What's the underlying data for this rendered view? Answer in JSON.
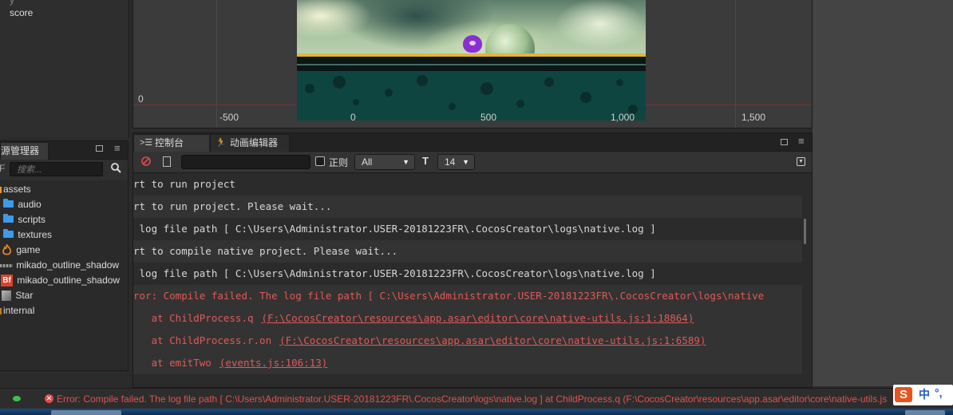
{
  "hierarchy": {
    "items": [
      "score"
    ]
  },
  "assets_panel": {
    "tab_label": "源管理器",
    "search_placeholder": "搜索...",
    "items": [
      {
        "label": "assets",
        "icon": "folder-open-icon"
      },
      {
        "label": "audio",
        "icon": "folder-icon"
      },
      {
        "label": "scripts",
        "icon": "folder-icon"
      },
      {
        "label": "textures",
        "icon": "folder-icon"
      },
      {
        "label": "game",
        "icon": "fire-scene-icon"
      },
      {
        "label": "mikado_outline_shadow",
        "icon": "font-asset-icon"
      },
      {
        "label": "mikado_outline_shadow",
        "icon": "bitmap-font-icon"
      },
      {
        "label": "Star",
        "icon": "prefab-cube-icon"
      },
      {
        "label": "internal",
        "icon": "folder-open-icon"
      }
    ]
  },
  "scene": {
    "y_axis_label": "0",
    "x_axis_labels": [
      "-500",
      "0",
      "500",
      "1,000",
      "1,500"
    ]
  },
  "console": {
    "tabs": {
      "console": "控制台",
      "animation": "动画编辑器"
    },
    "regex_label": "正则",
    "level_select": "All",
    "font_size_select": "14",
    "logs": [
      {
        "text": "rt to run project",
        "type": "info"
      },
      {
        "text": "rt to run project. Please wait...",
        "type": "info"
      },
      {
        "text": " log file path [ C:\\Users\\Administrator.USER-20181223FR\\.CocosCreator\\logs\\native.log ]",
        "type": "info"
      },
      {
        "text": "rt to compile native project. Please wait...",
        "type": "info"
      },
      {
        "text": " log file path [ C:\\Users\\Administrator.USER-20181223FR\\.CocosCreator\\logs\\native.log ]",
        "type": "info"
      },
      {
        "text": "ror: Compile failed. The log file path [ C:\\Users\\Administrator.USER-20181223FR\\.CocosCreator\\logs\\native",
        "type": "error"
      }
    ],
    "stack": [
      {
        "prefix": "   at ChildProcess.q",
        "link": "(F:\\CocosCreator\\resources\\app.asar\\editor\\core\\native-utils.js:1:18864)"
      },
      {
        "prefix": "   at ChildProcess.r.on",
        "link": "(F:\\CocosCreator\\resources\\app.asar\\editor\\core\\native-utils.js:1:6589)"
      },
      {
        "prefix": "   at emitTwo",
        "link": "(events.js:106:13)"
      }
    ]
  },
  "status_bar": {
    "message": "Error: Compile failed. The log file path [ C:\\Users\\Administrator.USER-20181223FR\\.CocosCreator\\logs\\native.log ] at ChildProcess.q (F:\\CocosCreator\\resources\\app.asar\\editor\\core\\native-utils.js"
  },
  "ime": {
    "logo": "S",
    "mode": "中",
    "punct": "°,"
  },
  "colors": {
    "error": "#e05a5a",
    "accent_folder": "#3d9be9"
  }
}
